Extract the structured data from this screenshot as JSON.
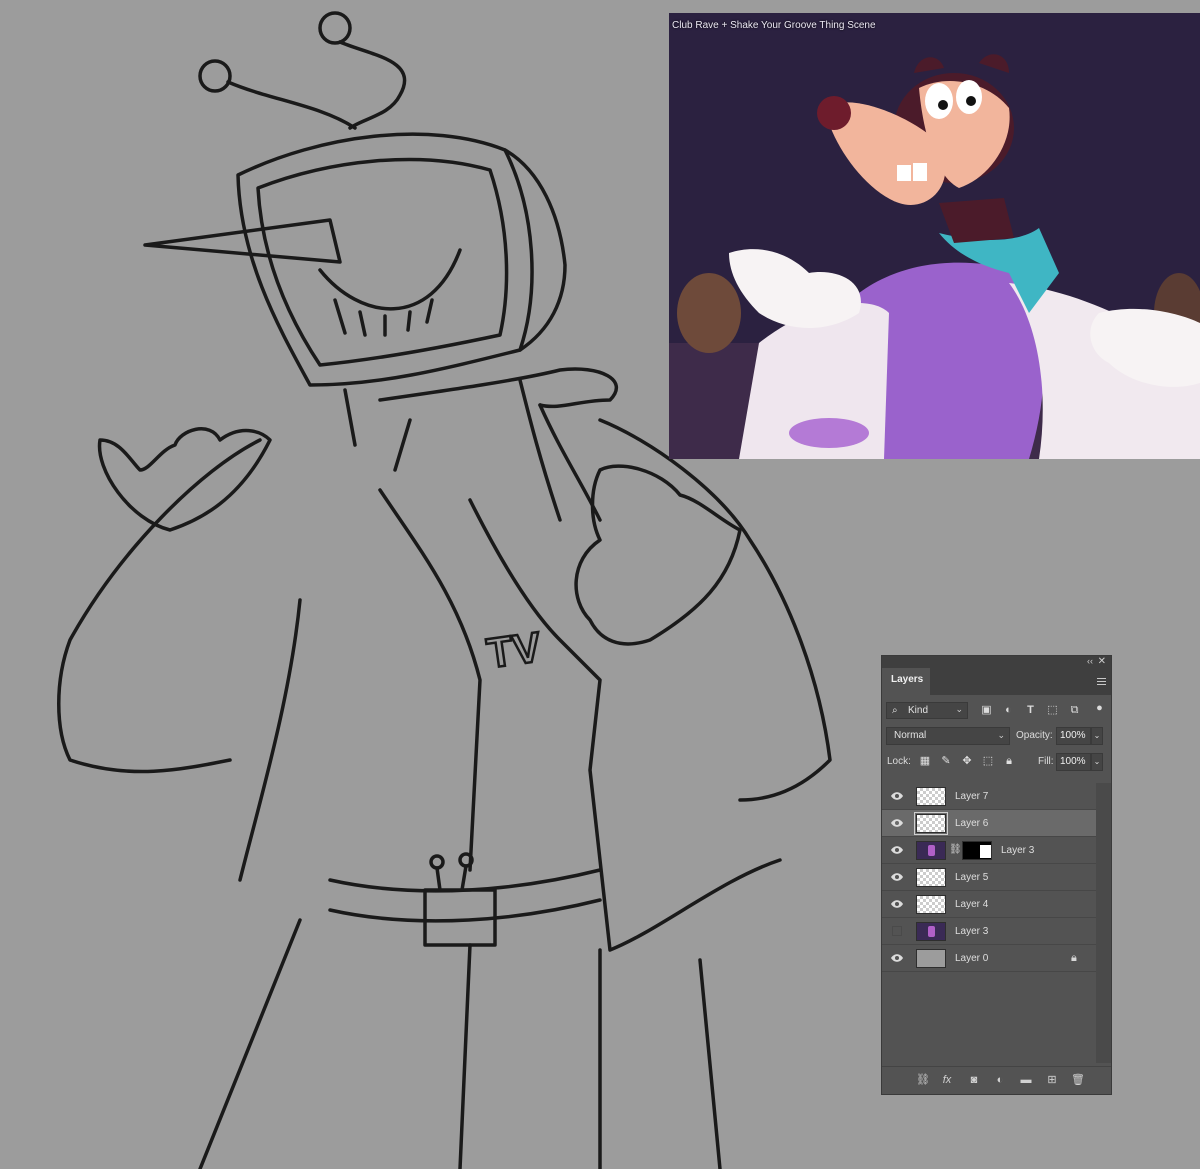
{
  "reference_window": {
    "title": "Club Rave + Shake Your Groove Thing Scene"
  },
  "sketch": {
    "chest_text": "TV"
  },
  "layers_panel": {
    "tab": "Layers",
    "filter_kind": "Kind",
    "blend_mode": "Normal",
    "opacity_label": "Opacity:",
    "opacity_value": "100%",
    "lock_label": "Lock:",
    "fill_label": "Fill:",
    "fill_value": "100%",
    "layers": [
      {
        "name": "Layer 7",
        "visible": true,
        "selected": false
      },
      {
        "name": "Layer 6",
        "visible": true,
        "selected": true
      },
      {
        "name": "Layer 3",
        "visible": true,
        "selected": false,
        "has_mask": true
      },
      {
        "name": "Layer 5",
        "visible": true,
        "selected": false
      },
      {
        "name": "Layer 4",
        "visible": true,
        "selected": false
      },
      {
        "name": "Layer 3",
        "visible": false,
        "selected": false
      },
      {
        "name": "Layer 0",
        "visible": true,
        "selected": false,
        "locked": true
      }
    ]
  },
  "colors": {
    "canvas_bg": "#9c9c9c",
    "panel_bg": "#535353",
    "selected_row": "#6a6a6a"
  }
}
